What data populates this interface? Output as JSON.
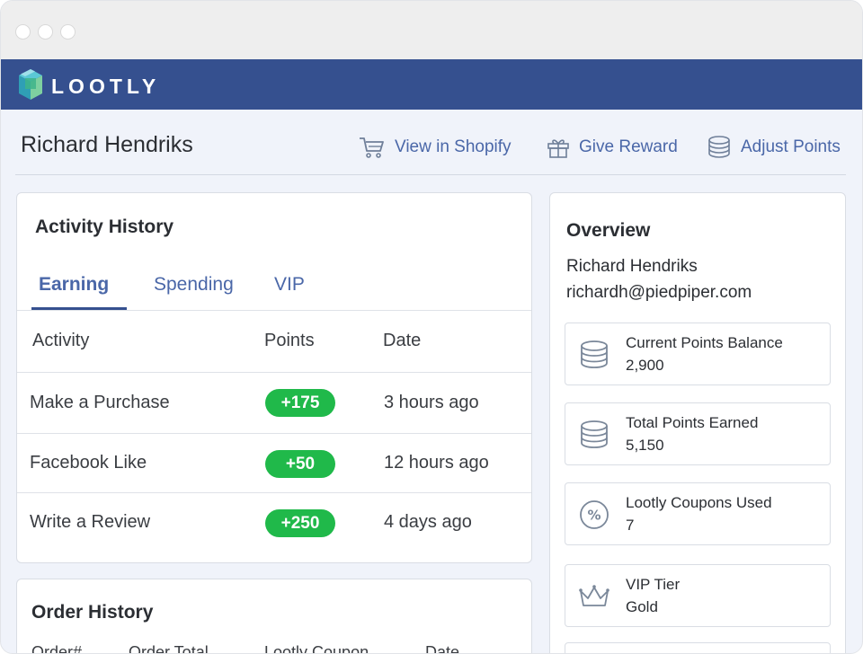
{
  "brand": {
    "name": "LOOTLY",
    "navbar_color": "#35508f",
    "accent_color": "#4a67a8",
    "badge_color": "#20b94a"
  },
  "customer": {
    "name": "Richard Hendriks"
  },
  "actions": [
    {
      "label": "View in Shopify",
      "icon": "cart-icon"
    },
    {
      "label": "Give Reward",
      "icon": "gift-icon"
    },
    {
      "label": "Adjust Points",
      "icon": "coins-icon"
    }
  ],
  "activity": {
    "title": "Activity History",
    "tabs": [
      {
        "label": "Earning",
        "active": true
      },
      {
        "label": "Spending",
        "active": false
      },
      {
        "label": "VIP",
        "active": false
      }
    ],
    "columns": [
      "Activity",
      "Points",
      "Date"
    ],
    "rows": [
      {
        "activity": "Make a Purchase",
        "points": "+175",
        "date": "3 hours ago"
      },
      {
        "activity": "Facebook Like",
        "points": "+50",
        "date": "12 hours ago"
      },
      {
        "activity": "Write a Review",
        "points": "+250",
        "date": "4 days ago"
      }
    ]
  },
  "orders": {
    "title": "Order History",
    "columns": [
      "Order#",
      "Order Total",
      "Lootly Coupon",
      "Date"
    ]
  },
  "overview": {
    "title": "Overview",
    "name": "Richard Hendriks",
    "email": "richardh@piedpiper.com",
    "stats": [
      {
        "label": "Current Points Balance",
        "value": "2,900",
        "icon": "coins-icon"
      },
      {
        "label": "Total Points Earned",
        "value": "5,150",
        "icon": "coins-icon"
      },
      {
        "label": "Lootly Coupons Used",
        "value": "7",
        "icon": "percent-icon"
      },
      {
        "label": "VIP Tier",
        "value": "Gold",
        "icon": "crown-icon"
      }
    ]
  }
}
